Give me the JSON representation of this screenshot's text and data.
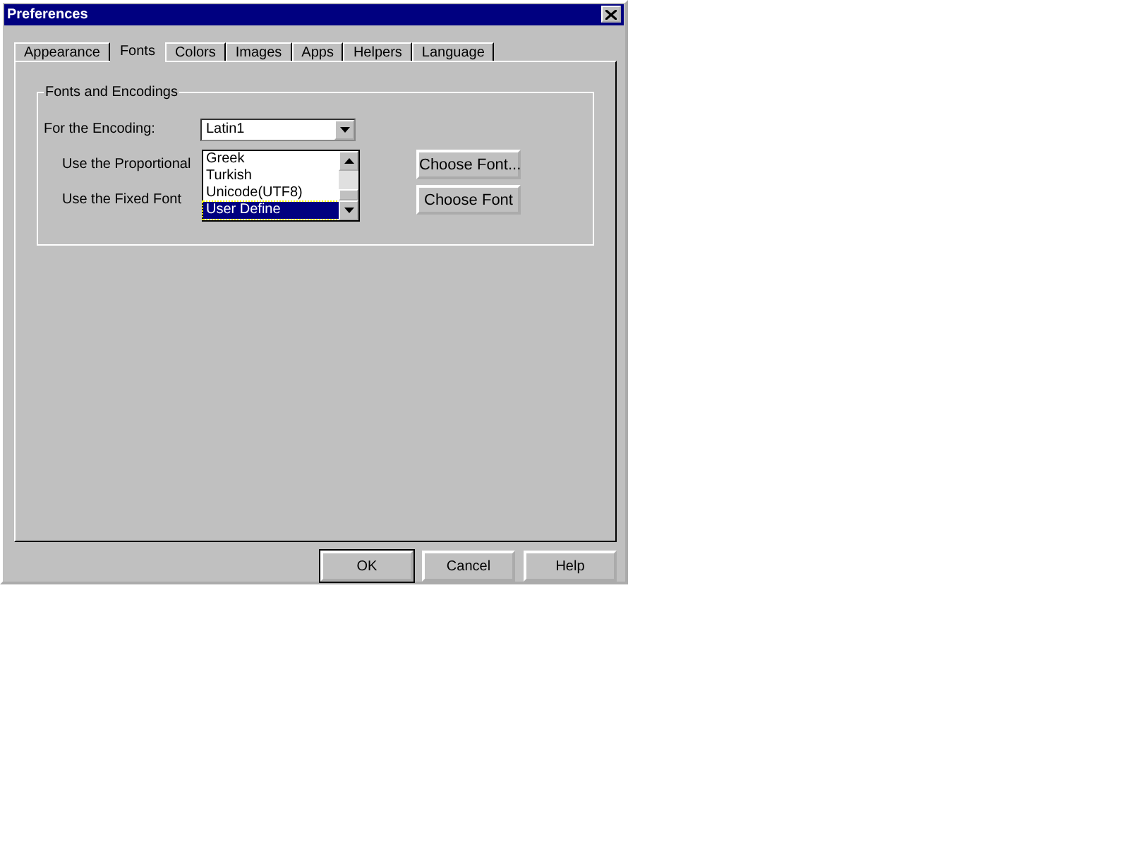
{
  "window": {
    "title": "Preferences"
  },
  "tabs": [
    {
      "label": "Appearance",
      "selected": false
    },
    {
      "label": "Fonts",
      "selected": true
    },
    {
      "label": "Colors",
      "selected": false
    },
    {
      "label": "Images",
      "selected": false
    },
    {
      "label": "Apps",
      "selected": false
    },
    {
      "label": "Helpers",
      "selected": false
    },
    {
      "label": "Language",
      "selected": false
    }
  ],
  "group": {
    "title": "Fonts and Encodings",
    "encoding": {
      "label": "For the Encoding:",
      "value": "Latin1",
      "expanded": true,
      "options": [
        {
          "label": "Greek",
          "selected": false
        },
        {
          "label": "Turkish",
          "selected": false
        },
        {
          "label": "Unicode(UTF8)",
          "selected": false
        },
        {
          "label": "User Define",
          "selected": true
        }
      ]
    },
    "rows": [
      {
        "label": "Use the Proportional",
        "button": "Choose Font..."
      },
      {
        "label": "Use the Fixed Font",
        "button": "Choose Font"
      }
    ]
  },
  "buttons": [
    "OK",
    "Cancel",
    "Help"
  ]
}
